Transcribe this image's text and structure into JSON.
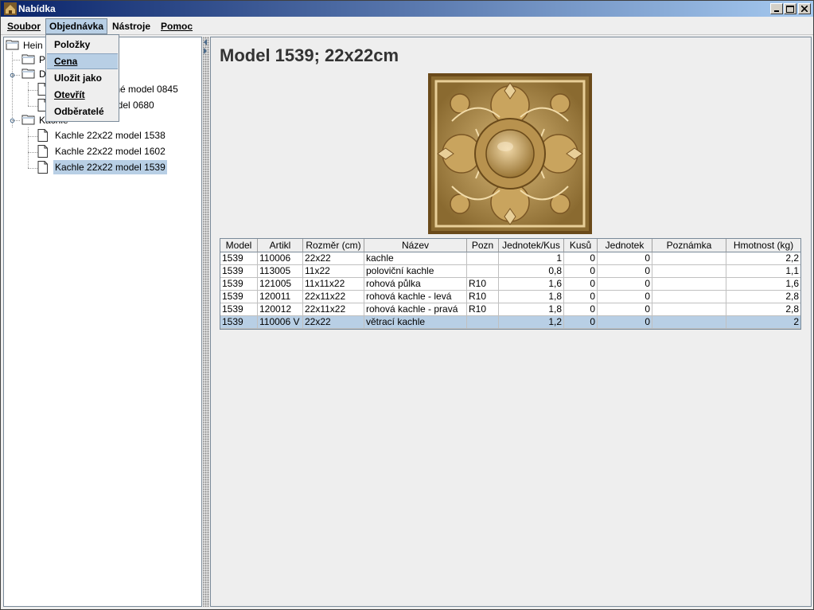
{
  "window": {
    "title": "Nabídka"
  },
  "menubar": {
    "items": [
      {
        "label": "Soubor"
      },
      {
        "label": "Objednávka"
      },
      {
        "label": "Nástroje"
      },
      {
        "label": "Pomoc"
      }
    ]
  },
  "dropdown": {
    "items": [
      {
        "label": "Položky"
      },
      {
        "label": "Cena"
      },
      {
        "label": "Uložit jako"
      },
      {
        "label": "Otevřít"
      },
      {
        "label": "Odběratelé"
      }
    ]
  },
  "tree": {
    "root": "Hein",
    "nodes": [
      {
        "label": "Po"
      },
      {
        "label": "De"
      },
      {
        "label": "obné model 0845"
      },
      {
        "label": "model 0680"
      },
      {
        "label": "Kachle"
      },
      {
        "label": "Kachle 22x22 model 1538"
      },
      {
        "label": "Kachle 22x22 model 1602"
      },
      {
        "label": "Kachle 22x22 model 1539"
      }
    ]
  },
  "detail": {
    "title": "Model 1539; 22x22cm",
    "table": {
      "columns": [
        "Model",
        "Artikl",
        "Rozměr (cm)",
        "Název",
        "Pozn",
        "Jednotek/Kus",
        "Kusů",
        "Jednotek",
        "Poznámka",
        "Hmotnost (kg)"
      ],
      "rows": [
        [
          "1539",
          "110006",
          "22x22",
          "kachle",
          "",
          "1",
          "0",
          "0",
          "",
          "2,2"
        ],
        [
          "1539",
          "113005",
          "11x22",
          "poloviční kachle",
          "",
          "0,8",
          "0",
          "0",
          "",
          "1,1"
        ],
        [
          "1539",
          "121005",
          "11x11x22",
          "rohová půlka",
          "R10",
          "1,6",
          "0",
          "0",
          "",
          "1,6"
        ],
        [
          "1539",
          "120011",
          "22x11x22",
          "rohová kachle - levá",
          "R10",
          "1,8",
          "0",
          "0",
          "",
          "2,8"
        ],
        [
          "1539",
          "120012",
          "22x11x22",
          "rohová kachle - pravá",
          "R10",
          "1,8",
          "0",
          "0",
          "",
          "2,8"
        ],
        [
          "1539",
          "110006 V",
          "22x22",
          "větrací kachle",
          "",
          "1,2",
          "0",
          "0",
          "",
          "2"
        ]
      ]
    }
  }
}
